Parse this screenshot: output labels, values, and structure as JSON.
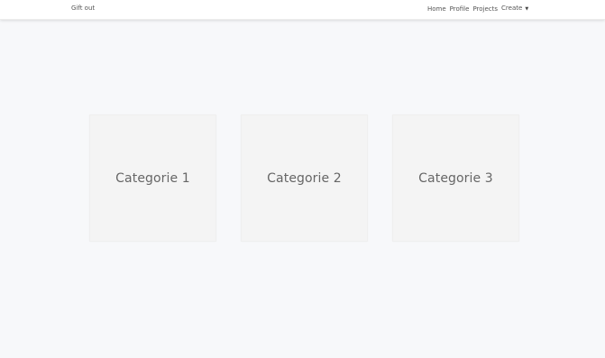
{
  "navbar": {
    "brand": "Gift out",
    "links": [
      {
        "label": "Home"
      },
      {
        "label": "Profile"
      },
      {
        "label": "Projects"
      },
      {
        "label": "Create"
      }
    ],
    "dropdown_caret": "▼"
  },
  "categories": [
    {
      "label": "Categorie 1"
    },
    {
      "label": "Categorie 2"
    },
    {
      "label": "Categorie 3"
    }
  ],
  "colors": {
    "page_background": "#f7f8fa",
    "navbar_background": "#ffffff",
    "card_background": "#f4f4f4",
    "text": "#555555"
  }
}
